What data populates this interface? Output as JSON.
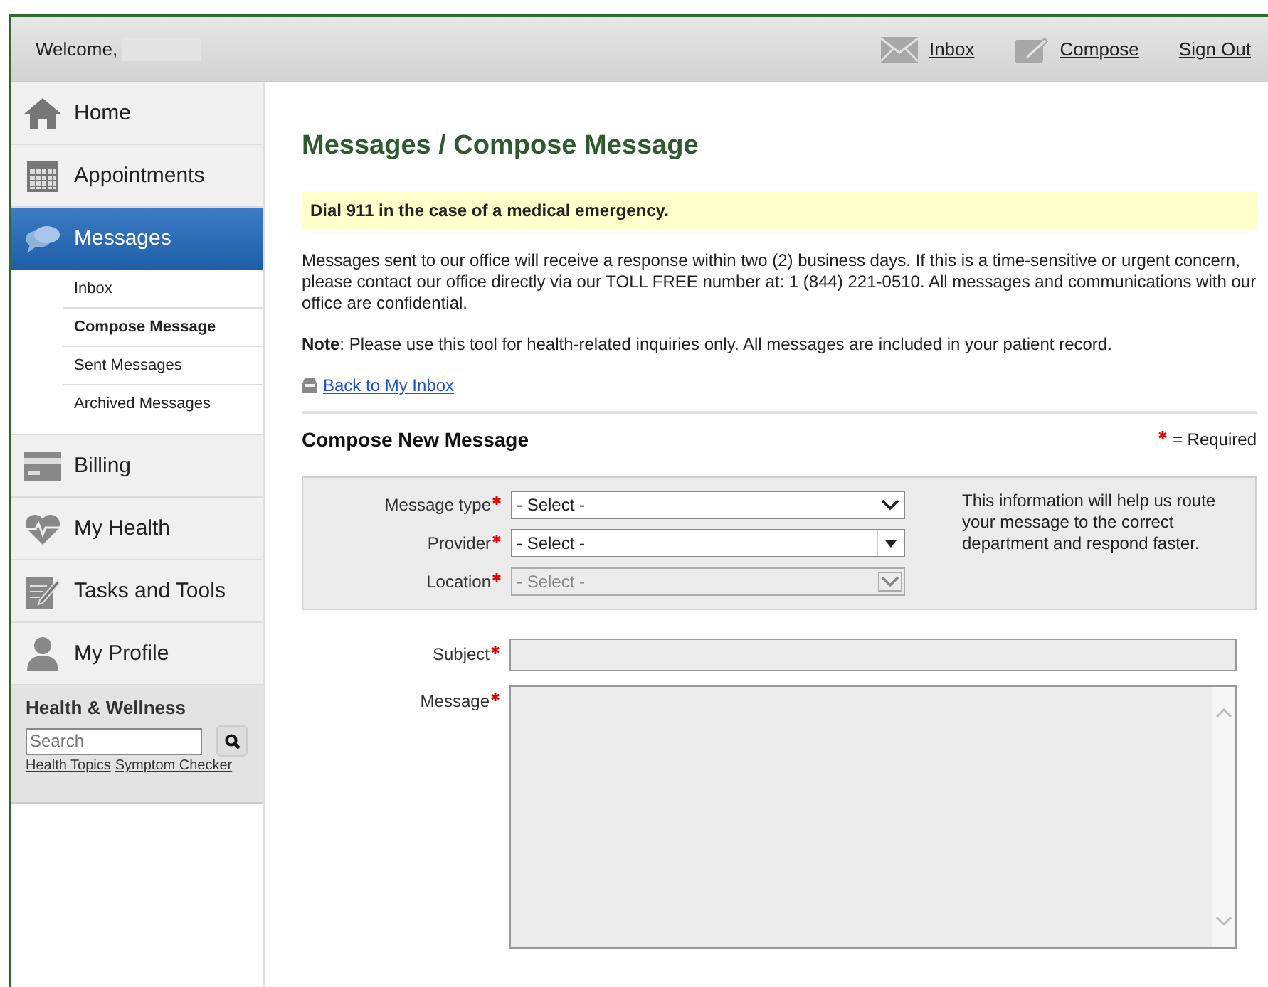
{
  "header": {
    "welcome": "Welcome,",
    "links": [
      {
        "kind": "inbox",
        "label": "Inbox"
      },
      {
        "kind": "compose",
        "label": "Compose"
      },
      {
        "kind": "signout",
        "label": "Sign Out"
      }
    ]
  },
  "sidebar": {
    "items": [
      {
        "label": "Home",
        "selected": false
      },
      {
        "label": "Appointments",
        "selected": false
      },
      {
        "label": "Messages",
        "selected": true,
        "children": [
          {
            "label": "Inbox",
            "selected": false
          },
          {
            "label": "Compose Message",
            "selected": true
          },
          {
            "label": "Sent Messages",
            "selected": false
          },
          {
            "label": "Archived Messages",
            "selected": false
          }
        ]
      },
      {
        "label": "Billing",
        "selected": false
      },
      {
        "label": "My Health",
        "selected": false
      },
      {
        "label": "Tasks and Tools",
        "selected": false
      },
      {
        "label": "My Profile",
        "selected": false
      }
    ],
    "wellness": {
      "title": "Health & Wellness",
      "search_placeholder": "Search",
      "links": [
        "Health Topics",
        "Symptom Checker"
      ]
    }
  },
  "content": {
    "title": "Messages / Compose Message",
    "alert": "Dial 911 in the case of a medical emergency.",
    "info": "Messages sent to our office will receive a response within two (2) business days. If this is a time-sensitive or urgent concern, please contact our office directly via our TOLL FREE number at: 1 (844) 221-0510. All messages and communications with our office are confidential.",
    "note": "**Note**: Please use this tool for health-related inquiries only. All messages are included in your patient record.",
    "back_link": "Back to My Inbox",
    "section_title": "Compose New Message",
    "required_legend": "= Required",
    "routing": {
      "fields": [
        {
          "kind": "select",
          "label": "Message type",
          "required": true,
          "value": "- Select -",
          "disabled": false
        },
        {
          "kind": "combo",
          "label": "Provider",
          "required": true,
          "value": "- Select -",
          "disabled": false
        },
        {
          "kind": "select",
          "label": "Location",
          "required": true,
          "value": "- Select -",
          "disabled": true
        }
      ],
      "help": "This information will help us route your message to the correct department and respond faster."
    },
    "fields": [
      {
        "kind": "text",
        "label": "Subject",
        "required": true
      },
      {
        "kind": "textarea",
        "label": "Message",
        "required": true
      }
    ]
  }
}
